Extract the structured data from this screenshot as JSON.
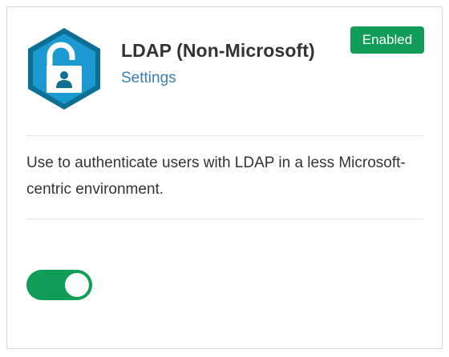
{
  "integration": {
    "title": "LDAP (Non-Microsoft)",
    "settings_link": "Settings",
    "status_badge": "Enabled",
    "description": "Use to authenticate users with LDAP in a less Microsoft-centric environment.",
    "icon": "padlock-user-icon",
    "enabled": true
  },
  "colors": {
    "accent_green": "#0f9d58",
    "link_blue": "#3c7fb5",
    "logo_outer": "#0d6f94",
    "logo_inner": "#1a9ad0"
  }
}
